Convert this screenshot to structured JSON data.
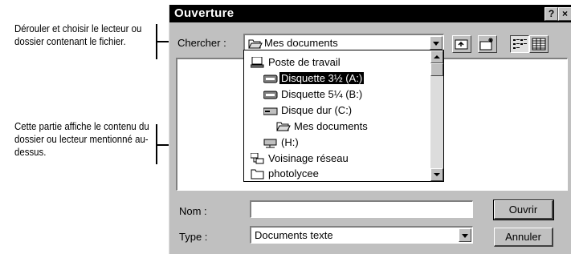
{
  "annotations": {
    "top": "Dérouler et choisir le lecteur ou dossier contenant le fichier.",
    "middle": "Cette partie affiche le contenu du dossier ou lecteur mentionné au-dessus."
  },
  "dialog": {
    "title": "Ouverture",
    "help_label": "?",
    "close_label": "×",
    "look_in_label": "Chercher :",
    "look_in_value": "Mes documents",
    "dropdown_items": [
      {
        "label": "Poste de travail",
        "icon": "computer-icon"
      },
      {
        "label": "Disquette 3½ (A:)",
        "icon": "floppy-icon"
      },
      {
        "label": "Disquette 5¼ (B:)",
        "icon": "floppy-icon"
      },
      {
        "label": "Disque dur (C:)",
        "icon": "hard-drive-icon"
      },
      {
        "label": "Mes documents",
        "icon": "folder-open-icon"
      },
      {
        "label": "(H:)",
        "icon": "network-drive-icon"
      },
      {
        "label": "Voisinage réseau",
        "icon": "network-icon"
      },
      {
        "label": "photolycee",
        "icon": "folder-icon"
      }
    ],
    "name_label": "Nom :",
    "name_value": "",
    "type_label": "Type :",
    "type_value": "Documents texte",
    "open_button": "Ouvrir",
    "cancel_button": "Annuler"
  }
}
